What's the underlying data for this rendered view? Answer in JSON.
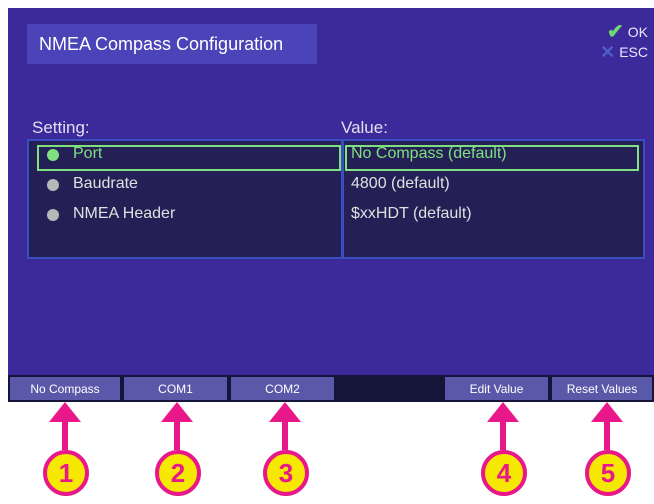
{
  "screen": {
    "title": "NMEA Compass Configuration",
    "legend": {
      "ok_label": "OK",
      "esc_label": "ESC"
    }
  },
  "table": {
    "setting_header": "Setting:",
    "value_header": "Value:",
    "rows": [
      {
        "setting": "Port",
        "value": "No Compass (default)",
        "selected": true
      },
      {
        "setting": "Baudrate",
        "value": "4800 (default)",
        "selected": false
      },
      {
        "setting": "NMEA Header",
        "value": "$xxHDT (default)",
        "selected": false
      }
    ]
  },
  "softkeys": [
    {
      "label": "No Compass"
    },
    {
      "label": "COM1"
    },
    {
      "label": "COM2"
    },
    {
      "label": ""
    },
    {
      "label": "Edit Value"
    },
    {
      "label": "Reset Values"
    }
  ],
  "callouts": [
    "1",
    "2",
    "3",
    "4",
    "5"
  ],
  "colors": {
    "screen_bg": "#3c2a9a",
    "selection": "#7fe07f",
    "callout_magenta": "#e8188a",
    "callout_yellow": "#f6e800"
  }
}
